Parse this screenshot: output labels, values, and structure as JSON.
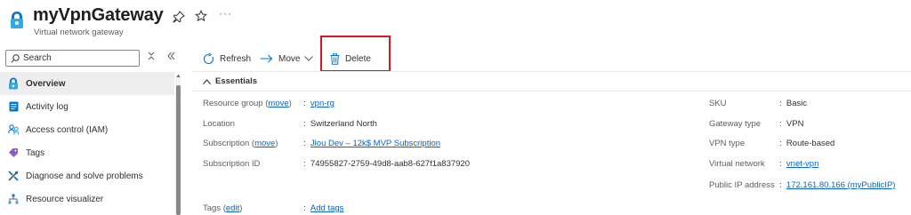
{
  "header": {
    "title": "myVpnGateway",
    "subtitle": "Virtual network gateway",
    "more_label": "···"
  },
  "sidebar": {
    "search_placeholder": "Search",
    "items": [
      {
        "label": "Overview",
        "icon": "vpn-gateway-icon",
        "active": true
      },
      {
        "label": "Activity log",
        "icon": "activity-log-icon"
      },
      {
        "label": "Access control (IAM)",
        "icon": "people-icon"
      },
      {
        "label": "Tags",
        "icon": "tag-icon"
      },
      {
        "label": "Diagnose and solve problems",
        "icon": "wrench-icon"
      },
      {
        "label": "Resource visualizer",
        "icon": "hierarchy-icon"
      }
    ]
  },
  "toolbar": {
    "refresh_label": "Refresh",
    "move_label": "Move",
    "delete_label": "Delete"
  },
  "essentials": {
    "header_label": "Essentials",
    "resource_group": {
      "label": "Resource group",
      "link": "move",
      "value": "vpn-rg"
    },
    "location": {
      "label": "Location",
      "value": "Switzerland North"
    },
    "subscription": {
      "label": "Subscription",
      "link": "move",
      "value": "Jlou Dev – 12k$ MVP Subscription"
    },
    "subscription_id": {
      "label": "Subscription ID",
      "value": "74955827-2759-49d8-aab8-627f1a837920"
    },
    "tags": {
      "label": "Tags",
      "link": "edit",
      "value": "Add tags"
    },
    "sku": {
      "label": "SKU",
      "value": "Basic"
    },
    "gateway_type": {
      "label": "Gateway type",
      "value": "VPN"
    },
    "vpn_type": {
      "label": "VPN type",
      "value": "Route-based"
    },
    "virtual_network": {
      "label": "Virtual network",
      "value": "vnet-vpn"
    },
    "public_ip": {
      "label": "Public IP address",
      "value": "172.161.80.166 (myPublicIP)"
    }
  },
  "colors": {
    "link": "#0b63c5",
    "accent": "#0078d4",
    "highlight_box": "#e0141e"
  }
}
